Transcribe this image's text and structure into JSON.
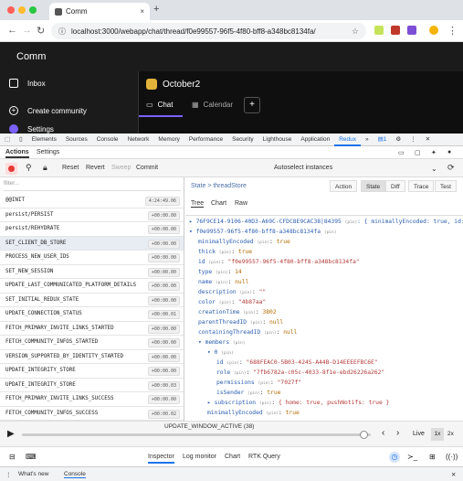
{
  "browser": {
    "tab_title": "Comm",
    "tab_close": "×",
    "new_tab": "+",
    "url": "localhost:3000/webapp/chat/thread/f0e99557-96f5-4f80-bff8-a348bc8134fa/"
  },
  "app": {
    "name": "Comm",
    "sidebar": [
      {
        "label": "Inbox"
      },
      {
        "label": "Create community"
      },
      {
        "label": "Settings"
      }
    ],
    "thread_title": "October2",
    "thread_tabs": [
      {
        "label": "Chat"
      },
      {
        "label": "Calendar"
      }
    ],
    "plus": "+"
  },
  "devtools": {
    "tabs": [
      "Elements",
      "Sources",
      "Console",
      "Network",
      "Memory",
      "Performance",
      "Security",
      "Lighthouse",
      "Application",
      "Redux",
      "»"
    ],
    "active_tab": "Redux",
    "badge": "1",
    "redux_tabs": {
      "actions": "Actions",
      "settings": "Settings"
    },
    "toolbar": {
      "reset": "Reset",
      "revert": "Revert",
      "sweep": "Sweep",
      "commit": "Commit",
      "autoselect": "Autoselect instances"
    },
    "filter_placeholder": "filter...",
    "actions": [
      {
        "name": "@@INIT",
        "time": "4:24:49.06"
      },
      {
        "name": "persist/PERSIST",
        "time": "+00:00.00"
      },
      {
        "name": "persist/REHYDRATE",
        "time": "+00:00.00"
      },
      {
        "name": "SET_CLIENT_DB_STORE",
        "time": "+00:00.00"
      },
      {
        "name": "PROCESS_NEW_USER_IDS",
        "time": "+00:00.00"
      },
      {
        "name": "SET_NEW_SESSION",
        "time": "+00:00.00"
      },
      {
        "name": "UPDATE_LAST_COMMUNICATED_PLATFORM_DETAILS",
        "time": "+00:00.00"
      },
      {
        "name": "SET_INITIAL_REDUX_STATE",
        "time": "+00:00.00"
      },
      {
        "name": "UPDATE_CONNECTION_STATUS",
        "time": "+00:00.01"
      },
      {
        "name": "FETCH_PRIMARY_INVITE_LINKS_STARTED",
        "time": "+00:00.00"
      },
      {
        "name": "FETCH_COMMUNITY_INFOS_STARTED",
        "time": "+00:00.00"
      },
      {
        "name": "VERSION_SUPPORTED_BY_IDENTITY_STARTED",
        "time": "+00:00.00"
      },
      {
        "name": "UPDATE_INTEGRITY_STORE",
        "time": "+00:00.00"
      },
      {
        "name": "UPDATE_INTEGRITY_STORE",
        "time": "+00:00.03"
      },
      {
        "name": "FETCH_PRIMARY_INVITE_LINKS_SUCCESS",
        "time": "+00:00.00"
      },
      {
        "name": "FETCH_COMMUNITY_INFOS_SUCCESS",
        "time": "+00:00.02"
      }
    ],
    "breadcrumb": "State > threadStore",
    "view_buttons": [
      "Action",
      "State",
      "Diff",
      "Trace",
      "Test"
    ],
    "sub_tabs": [
      "Tree",
      "Chart",
      "Raw"
    ],
    "tree": [
      {
        "indent": 0,
        "text": "▸ 76F9CE14-9106-40D3-A69C-CFDC8E9CAC38|84395",
        "type": "(pin)",
        "rest": ": { minimallyEncoded: true, id: \""
      },
      {
        "indent": 0,
        "text": "▾ f0e99557-96f5-4f80-bff8-a348bc8134fa",
        "type": "(pin)",
        "rest": ""
      },
      {
        "indent": 1,
        "key": "minimallyEncoded",
        "type": "(pin)",
        "val": "true",
        "cls": "n"
      },
      {
        "indent": 1,
        "key": "thick",
        "type": "(pin)",
        "val": "true",
        "cls": "n"
      },
      {
        "indent": 1,
        "key": "id",
        "type": "(pin)",
        "val": "\"f0e99557-96f5-4f80-bff8-a348bc8134fa\"",
        "cls": "s"
      },
      {
        "indent": 1,
        "key": "type",
        "type": "(pin)",
        "val": "14",
        "cls": "n"
      },
      {
        "indent": 1,
        "key": "name",
        "type": "(pin)",
        "val": "null",
        "cls": "n"
      },
      {
        "indent": 1,
        "key": "description",
        "type": "(pin)",
        "val": "\"\"",
        "cls": "s"
      },
      {
        "indent": 1,
        "key": "color",
        "type": "(pin)",
        "val": "\"4b87aa\"",
        "cls": "s"
      },
      {
        "indent": 1,
        "key": "creationTime",
        "type": "(pin)",
        "val": "3802",
        "cls": "n"
      },
      {
        "indent": 1,
        "key": "parentThreadID",
        "type": "(pin)",
        "val": "null",
        "cls": "n"
      },
      {
        "indent": 1,
        "key": "containingThreadID",
        "type": "(pin)",
        "val": "null",
        "cls": "n"
      },
      {
        "indent": 1,
        "key": "▾ members",
        "type": "(pin)",
        "val": "",
        "cls": "n"
      },
      {
        "indent": 2,
        "key": "▾ 0",
        "type": "(pin)",
        "val": "",
        "cls": "n"
      },
      {
        "indent": 3,
        "key": "id",
        "type": "(pin)",
        "val": "\"688FEAC0-5B03-424S-A44B-D14EEEEFBC6E\"",
        "cls": "s"
      },
      {
        "indent": 3,
        "key": "role",
        "type": "(pin)",
        "val": "\"7fb6782a-c05c-4033-8f1e-ebd26226a262\"",
        "cls": "s"
      },
      {
        "indent": 3,
        "key": "permissions",
        "type": "(pin)",
        "val": "\"7027f\"",
        "cls": "s"
      },
      {
        "indent": 3,
        "key": "isSender",
        "type": "(pin)",
        "val": "true",
        "cls": "n"
      },
      {
        "indent": 2,
        "key": "▸ subscription",
        "type": "(pin)",
        "val": "{ home: true, pushNotifs: true }",
        "cls": "s"
      },
      {
        "indent": 2,
        "key": "minimallyEncoded",
        "type": "(pin)",
        "val": "true",
        "cls": "n"
      }
    ],
    "slider": {
      "label": "UPDATE_WINDOW_ACTIVE (38)",
      "live": "Live",
      "speed1": "1x",
      "speed2": "2x",
      "position": 0.98
    },
    "bottom_tabs": [
      "Inspector",
      "Log monitor",
      "Chart",
      "RTK Query"
    ],
    "drawer": [
      "What's new",
      "Console"
    ]
  },
  "colors": {
    "accent": "#1a73e8",
    "redux_record": "#e53935",
    "app_bg": "#1b1b1b",
    "chat_accent": "#7b61ff"
  }
}
